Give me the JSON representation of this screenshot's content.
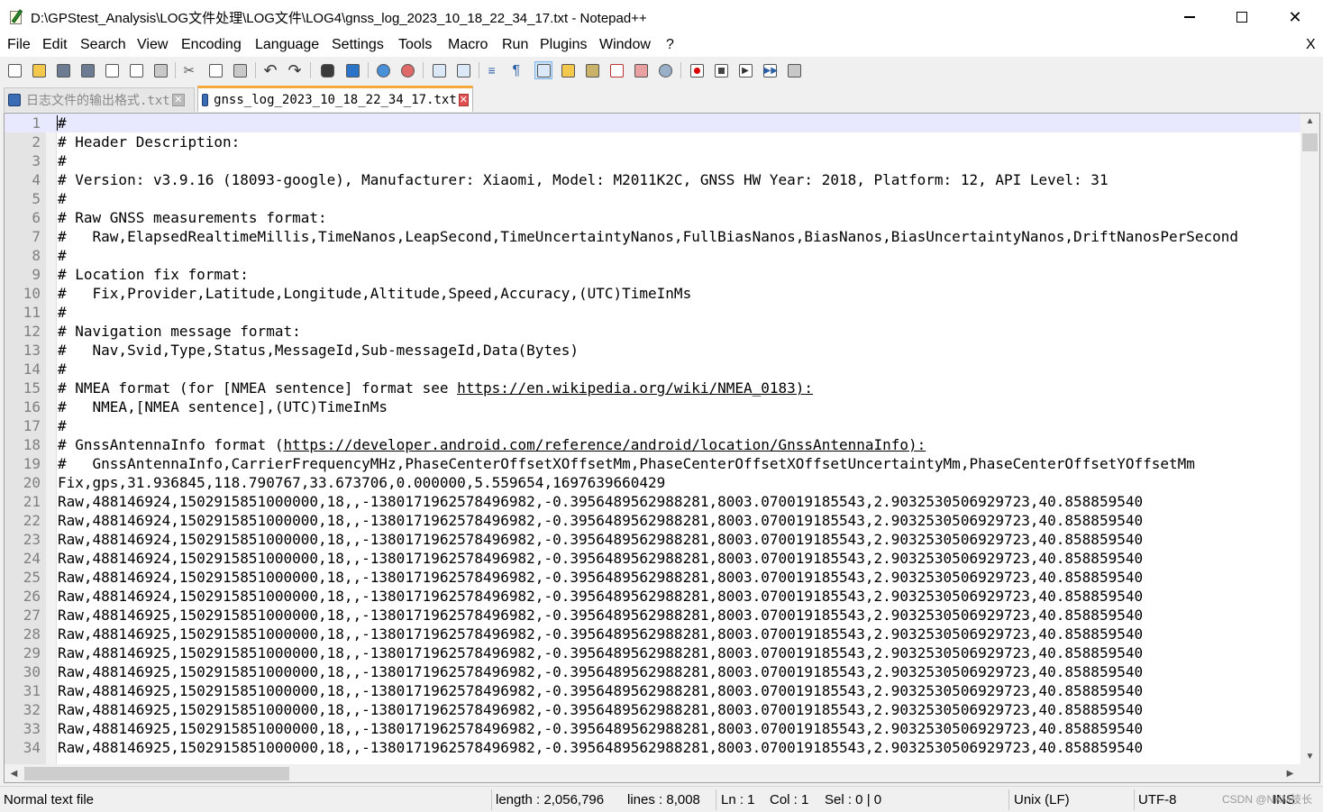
{
  "window": {
    "title": "D:\\GPStest_Analysis\\LOG文件处理\\LOG文件\\LOG4\\gnss_log_2023_10_18_22_34_17.txt - Notepad++",
    "minimize": "—",
    "maximize": "",
    "close": "✕"
  },
  "menu": {
    "items": [
      "File",
      "Edit",
      "Search",
      "View",
      "Encoding",
      "Language",
      "Settings",
      "Tools",
      "Macro",
      "Run",
      "Plugins",
      "Window",
      "?"
    ],
    "close_doc": "X"
  },
  "toolbar": {
    "icons": [
      "new-file-icon",
      "open-file-icon",
      "save-icon",
      "save-all-icon",
      "close-icon",
      "close-all-icon",
      "print-icon",
      "cut-icon",
      "copy-icon",
      "paste-icon",
      "undo-icon",
      "redo-icon",
      "find-icon",
      "replace-icon",
      "zoom-in-icon",
      "zoom-out-icon",
      "sync-vertical-icon",
      "sync-horizontal-icon",
      "word-wrap-icon",
      "show-all-characters-icon",
      "indent-guide-icon",
      "user-language-icon",
      "document-map-icon",
      "function-list-icon",
      "folder-workspace-icon",
      "monitoring-icon",
      "record-macro-icon",
      "stop-macro-icon",
      "play-macro-icon",
      "run-macro-multiple-icon",
      "save-macro-icon"
    ]
  },
  "tabs": [
    {
      "label": "日志文件的输出格式.txt",
      "close": "✕",
      "active": false
    },
    {
      "label": "gnss_log_2023_10_18_22_34_17.txt",
      "close": "✕",
      "active": true
    }
  ],
  "editor": {
    "lines": [
      {
        "num": "1",
        "text": "#"
      },
      {
        "num": "2",
        "text": "# Header Description:"
      },
      {
        "num": "3",
        "text": "#"
      },
      {
        "num": "4",
        "text": "# Version: v3.9.16 (18093-google), Manufacturer: Xiaomi, Model: M2011K2C, GNSS HW Year: 2018, Platform: 12, API Level: 31"
      },
      {
        "num": "5",
        "text": "#"
      },
      {
        "num": "6",
        "text": "# Raw GNSS measurements format:"
      },
      {
        "num": "7",
        "text": "#   Raw,ElapsedRealtimeMillis,TimeNanos,LeapSecond,TimeUncertaintyNanos,FullBiasNanos,BiasNanos,BiasUncertaintyNanos,DriftNanosPerSecond"
      },
      {
        "num": "8",
        "text": "#"
      },
      {
        "num": "9",
        "text": "# Location fix format:"
      },
      {
        "num": "10",
        "text": "#   Fix,Provider,Latitude,Longitude,Altitude,Speed,Accuracy,(UTC)TimeInMs"
      },
      {
        "num": "11",
        "text": "#"
      },
      {
        "num": "12",
        "text": "# Navigation message format:"
      },
      {
        "num": "13",
        "text": "#   Nav,Svid,Type,Status,MessageId,Sub-messageId,Data(Bytes)"
      },
      {
        "num": "14",
        "text": "#"
      },
      {
        "num": "15",
        "prefix": "# NMEA format (for [NMEA sentence] format see ",
        "link": "https://en.wikipedia.org/wiki/NMEA_0183):",
        "suffix": ""
      },
      {
        "num": "16",
        "text": "#   NMEA,[NMEA sentence],(UTC)TimeInMs"
      },
      {
        "num": "17",
        "text": "#"
      },
      {
        "num": "18",
        "prefix": "# GnssAntennaInfo format (",
        "link": "https://developer.android.com/reference/android/location/GnssAntennaInfo):",
        "suffix": ""
      },
      {
        "num": "19",
        "text": "#   GnssAntennaInfo,CarrierFrequencyMHz,PhaseCenterOffsetXOffsetMm,PhaseCenterOffsetXOffsetUncertaintyMm,PhaseCenterOffsetYOffsetMm"
      },
      {
        "num": "20",
        "text": "Fix,gps,31.936845,118.790767,33.673706,0.000000,5.559654,1697639660429"
      },
      {
        "num": "21",
        "text": "Raw,488146924,1502915851000000,18,,-1380171962578496982,-0.3956489562988281,8003.070019185543,2.9032530506929723,40.858859540"
      },
      {
        "num": "22",
        "text": "Raw,488146924,1502915851000000,18,,-1380171962578496982,-0.3956489562988281,8003.070019185543,2.9032530506929723,40.858859540"
      },
      {
        "num": "23",
        "text": "Raw,488146924,1502915851000000,18,,-1380171962578496982,-0.3956489562988281,8003.070019185543,2.9032530506929723,40.858859540"
      },
      {
        "num": "24",
        "text": "Raw,488146924,1502915851000000,18,,-1380171962578496982,-0.3956489562988281,8003.070019185543,2.9032530506929723,40.858859540"
      },
      {
        "num": "25",
        "text": "Raw,488146924,1502915851000000,18,,-1380171962578496982,-0.3956489562988281,8003.070019185543,2.9032530506929723,40.858859540"
      },
      {
        "num": "26",
        "text": "Raw,488146924,1502915851000000,18,,-1380171962578496982,-0.3956489562988281,8003.070019185543,2.9032530506929723,40.858859540"
      },
      {
        "num": "27",
        "text": "Raw,488146925,1502915851000000,18,,-1380171962578496982,-0.3956489562988281,8003.070019185543,2.9032530506929723,40.858859540"
      },
      {
        "num": "28",
        "text": "Raw,488146925,1502915851000000,18,,-1380171962578496982,-0.3956489562988281,8003.070019185543,2.9032530506929723,40.858859540"
      },
      {
        "num": "29",
        "text": "Raw,488146925,1502915851000000,18,,-1380171962578496982,-0.3956489562988281,8003.070019185543,2.9032530506929723,40.858859540"
      },
      {
        "num": "30",
        "text": "Raw,488146925,1502915851000000,18,,-1380171962578496982,-0.3956489562988281,8003.070019185543,2.9032530506929723,40.858859540"
      },
      {
        "num": "31",
        "text": "Raw,488146925,1502915851000000,18,,-1380171962578496982,-0.3956489562988281,8003.070019185543,2.9032530506929723,40.858859540"
      },
      {
        "num": "32",
        "text": "Raw,488146925,1502915851000000,18,,-1380171962578496982,-0.3956489562988281,8003.070019185543,2.9032530506929723,40.858859540"
      },
      {
        "num": "33",
        "text": "Raw,488146925,1502915851000000,18,,-1380171962578496982,-0.3956489562988281,8003.070019185543,2.9032530506929723,40.858859540"
      },
      {
        "num": "34",
        "text": "Raw,488146925,1502915851000000,18,,-1380171962578496982,-0.3956489562988281,8003.070019185543,2.9032530506929723,40.858859540"
      }
    ]
  },
  "statusbar": {
    "file_type": "Normal text file",
    "length": "length : 2,056,796",
    "lines": "lines : 8,008",
    "ln": "Ln : 1",
    "col": "Col : 1",
    "sel": "Sel : 0 | 0",
    "eol": "Unix (LF)",
    "encoding": "UTF-8",
    "mode": "INS",
    "watermark": "CSDN @NKM技长"
  },
  "colors": {
    "current_line": "#e8e8ff",
    "gutter": "#e4e4e4",
    "active_tab_accent": "#f6a93b",
    "line_number": "#808080"
  }
}
